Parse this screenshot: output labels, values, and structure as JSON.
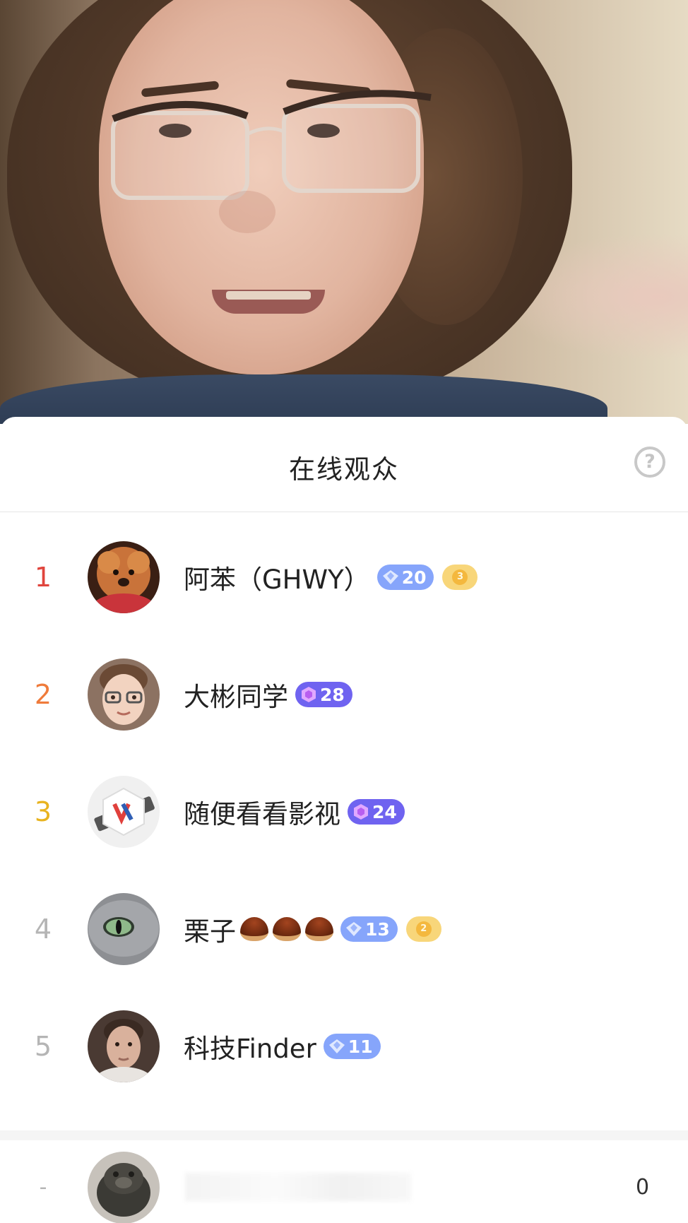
{
  "header": {
    "title": "在线观众",
    "help_icon": "?"
  },
  "ranking": [
    {
      "rank": "1",
      "rank_color": "#e0453d",
      "name": "阿苯（GHWY）",
      "badge": {
        "style": "light",
        "level": "20"
      },
      "coin": {
        "level": "3"
      },
      "avatar": "dog-avatar"
    },
    {
      "rank": "2",
      "rank_color": "#ef7b3b",
      "name": "大彬同学",
      "badge": {
        "style": "purple",
        "level": "28"
      },
      "coin": null,
      "avatar": "memoji-avatar"
    },
    {
      "rank": "3",
      "rank_color": "#e8b31f",
      "name": "随便看看影视",
      "badge": {
        "style": "purple",
        "level": "24"
      },
      "coin": null,
      "avatar": "film-logo-avatar"
    },
    {
      "rank": "4",
      "rank_color": "#b5b5b5",
      "name": "栗子",
      "name_emoji": "chestnut-icon x3",
      "badge": {
        "style": "light",
        "level": "13"
      },
      "coin": {
        "level": "2"
      },
      "avatar": "cat-eye-avatar"
    },
    {
      "rank": "5",
      "rank_color": "#b5b5b5",
      "name": "科技Finder",
      "badge": {
        "style": "light",
        "level": "11"
      },
      "coin": null,
      "avatar": "man-portrait-avatar"
    }
  ],
  "self": {
    "rank": "-",
    "score": "0",
    "avatar": "bronze-pig-avatar"
  }
}
